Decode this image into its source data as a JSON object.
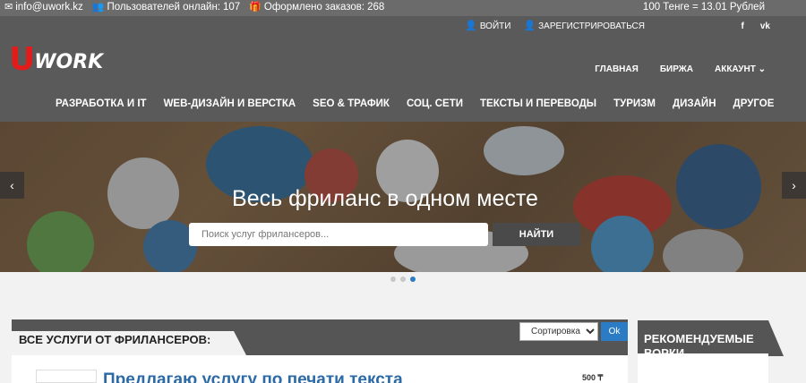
{
  "topbar": {
    "email": "info@uwork.kz",
    "online_label": "Пользователей онлайн:",
    "online_count": "107",
    "orders_label": "Оформлено заказов:",
    "orders_count": "268",
    "currency": "100 Тенге = 13.01 Рублей"
  },
  "auth": {
    "login": "ВОЙТИ",
    "register": "ЗАРЕГИСТРИРОВАТЬСЯ"
  },
  "social": {
    "facebook": "f",
    "vk": "vk"
  },
  "logo": {
    "letter": "U",
    "rest": "WORK"
  },
  "main_nav": [
    {
      "label": "ГЛАВНАЯ"
    },
    {
      "label": "БИРЖА"
    },
    {
      "label": "АККАУНТ"
    }
  ],
  "categories": [
    {
      "label": "РАЗРАБОТКА И IT"
    },
    {
      "label": "WEB-ДИЗАЙН И ВЕРСТКА"
    },
    {
      "label": "SEO & ТРАФИК"
    },
    {
      "label": "СОЦ. СЕТИ"
    },
    {
      "label": "ТЕКСТЫ И ПЕРЕВОДЫ"
    },
    {
      "label": "ТУРИЗМ"
    },
    {
      "label": "ДИЗАЙН"
    },
    {
      "label": "ДРУГОЕ"
    }
  ],
  "hero": {
    "title": "Весь фриланс в одном месте",
    "search_placeholder": "Поиск услуг фрилансеров...",
    "search_button": "НАЙТИ",
    "slides": 3,
    "active_slide": 3
  },
  "services": {
    "title": "ВСЕ УСЛУГИ ОТ ФРИЛАНСЕРОВ:",
    "sort_selected": "Сортировка",
    "ok_label": "Ok",
    "first_card_title": "Предлагаю услугу по печати текста",
    "first_card_price": "500 ₸"
  },
  "recommended": {
    "title_line1": "РЕКОМЕНДУЕМЫЕ",
    "title_line2": "ВОРКИ"
  },
  "colors": {
    "accent_blue": "#2b7cc4",
    "brand_red": "#e21b1b",
    "header_gray": "#5a5a5a",
    "topbar_gray": "#6b6b6b"
  }
}
